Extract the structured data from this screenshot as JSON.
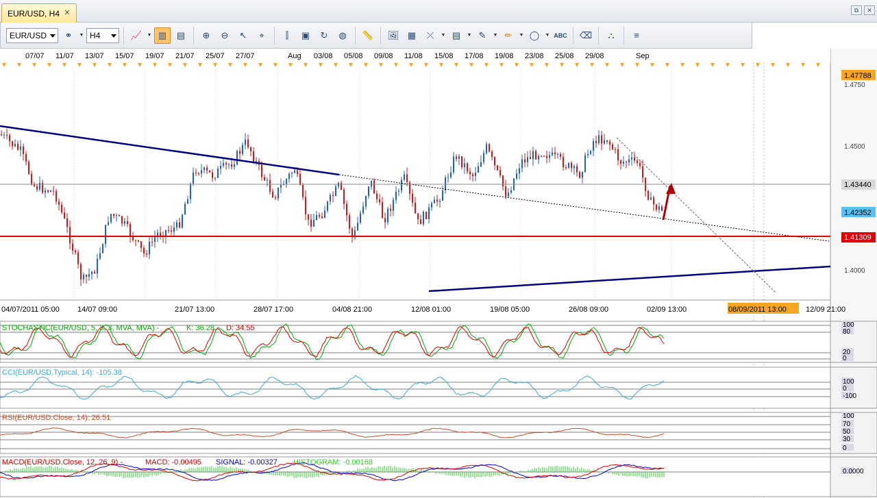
{
  "tab": {
    "title": "EUR/USD, H4",
    "close": "✕"
  },
  "window": {
    "restore": "⧉",
    "close": "✕"
  },
  "toolbar": {
    "symbol": "EUR/USD",
    "timeframe": "H4",
    "icons": [
      "chart-type-icon",
      "bar-chart-icon",
      "candle-chart-icon",
      "zoom-in-icon",
      "zoom-out-icon",
      "cursor-icon",
      "crosshair-icon",
      "vertical-line-icon",
      "select-icon",
      "refresh-icon",
      "globe-icon",
      "ruler-icon",
      "picture-icon",
      "template-icon",
      "line-tools-icon",
      "insert-icon",
      "pen-icon",
      "pencil-icon",
      "ellipse-icon",
      "text-icon",
      "eraser-icon",
      "org-icon",
      "more-icon"
    ]
  },
  "top_dates": [
    "07/07",
    "11/07",
    "13/07",
    "15/07",
    "19/07",
    "21/07",
    "25/07",
    "27/07",
    "Aug",
    "03/08",
    "05/08",
    "09/08",
    "11/08",
    "15/08",
    "17/08",
    "19/08",
    "23/08",
    "25/08",
    "29/08",
    "Sep"
  ],
  "price_labels": {
    "high": "1.47788",
    "l1": "1.4750",
    "l2": "1.4500",
    "current": "1.43440",
    "bid": "1.42352",
    "support": "1.41309",
    "l3": "1.4000"
  },
  "bottom_dates": [
    "04/07/2011 05:00",
    "14/07 09:00",
    "21/07 13:00",
    "28/07 17:00",
    "04/08 21:00",
    "12/08 01:00",
    "19/08 05:00",
    "26/08 09:00",
    "02/09 13:00",
    "08/09/2011 13:00",
    "12/09 21:00"
  ],
  "indicators": {
    "stoch": {
      "label": "STOCHASTIC(EUR/USD, 5, 3, 3, MVA, MVA) -",
      "k": "K: 36.28",
      "d": "D: 34.55",
      "scale": [
        "100",
        "80",
        "20",
        "0"
      ]
    },
    "cci": {
      "label": "CCI(EUR/USD.Typical, 14): -105.38",
      "scale": [
        "100",
        "0",
        "-100"
      ]
    },
    "rsi": {
      "label": "RSI(EUR/USD.Close, 14): 26.51",
      "scale": [
        "100",
        "70",
        "50",
        "30",
        "0"
      ]
    },
    "macd": {
      "label": "MACD(EUR/USD.Close, 12, 26, 9) -",
      "macd": "MACD: -0.00495",
      "signal": "SIGNAL: -0.00327",
      "histogram": "HISTOGRAM: -0.00168",
      "scale": [
        "0.0000"
      ]
    }
  },
  "colors": {
    "bull": "#1f5fbf",
    "bear": "#cc1a1a",
    "support": "#e00000",
    "trend": "#000080",
    "stoch_k": "#00aa00",
    "stoch_d": "#dd0000",
    "cci": "#3aa8d8",
    "rsi": "#c0502a",
    "macd": "#0000cc",
    "signal": "#dd0000",
    "hist": "#33cc33",
    "current_box": "#d9d9d9",
    "bid_box": "#5bc0f0",
    "support_box": "#e00000",
    "cursor_box": "#f5a623"
  }
}
